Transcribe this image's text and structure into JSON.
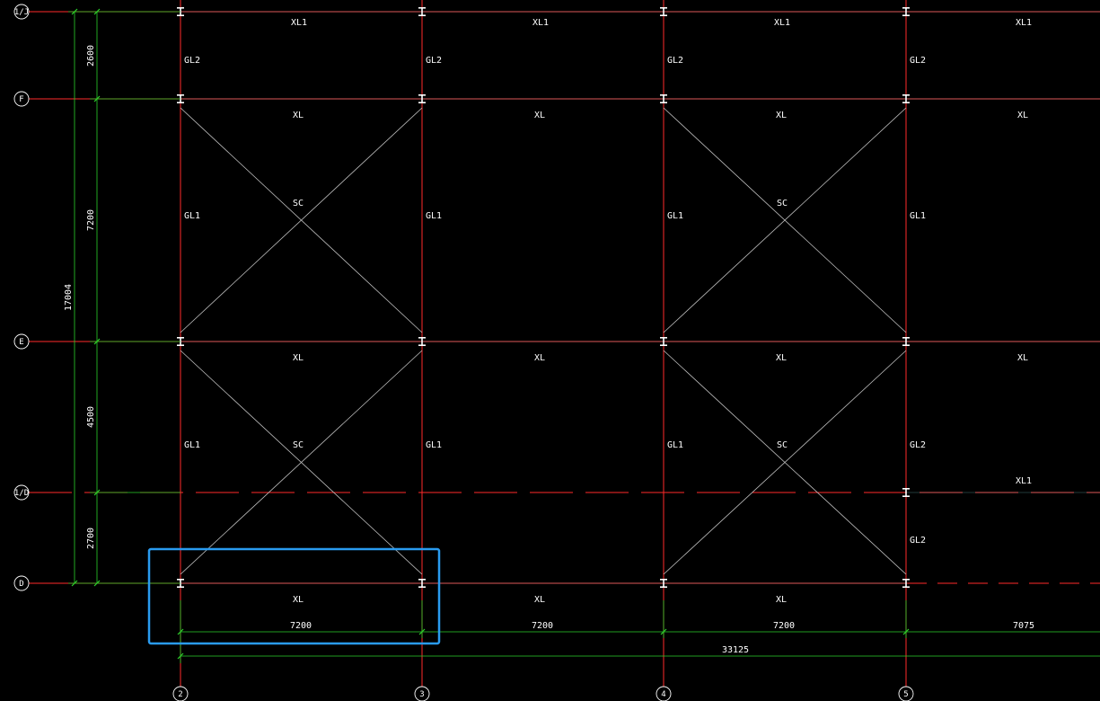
{
  "colors": {
    "background": "#000000",
    "grid_line": "#ff2a2a",
    "beam_line": "#ff2a2a",
    "brace_line": "#bfbfbf",
    "dimension_line": "#2bd12b",
    "text": "#ffffff",
    "column": "#ffffff",
    "selection_box": "#2a9bf0"
  },
  "row_axes": [
    "1/J",
    "F",
    "E",
    "1/D",
    "D"
  ],
  "column_axes": [
    "2",
    "3",
    "4",
    "5"
  ],
  "vertical_dimensions": {
    "overall": "17004",
    "segments": [
      "2600",
      "7200",
      "4500",
      "2700"
    ]
  },
  "horizontal_dimensions": {
    "segments": [
      "7200",
      "7200",
      "7200",
      "7075"
    ],
    "overall": "33125"
  },
  "beam_labels": {
    "row_1J": [
      "XL1",
      "XL1",
      "XL1",
      "XL1"
    ],
    "row_F": [
      "XL",
      "XL",
      "XL",
      "XL"
    ],
    "row_E": [
      "XL",
      "XL",
      "XL",
      "XL"
    ],
    "row_D": [
      "XL",
      "XL",
      "XL"
    ],
    "row_1D_right": "XL1"
  },
  "column_labels": {
    "bay_J_F": [
      "GL2",
      "GL2",
      "GL2",
      "GL2"
    ],
    "bay_F_E": [
      "GL1",
      "GL1",
      "GL1",
      "GL1"
    ],
    "bay_E_D": [
      "GL1",
      "GL1",
      "GL1",
      "GL2"
    ],
    "bay_1D_D_col5": "GL2"
  },
  "brace_labels": [
    "SC",
    "SC",
    "SC",
    "SC"
  ]
}
